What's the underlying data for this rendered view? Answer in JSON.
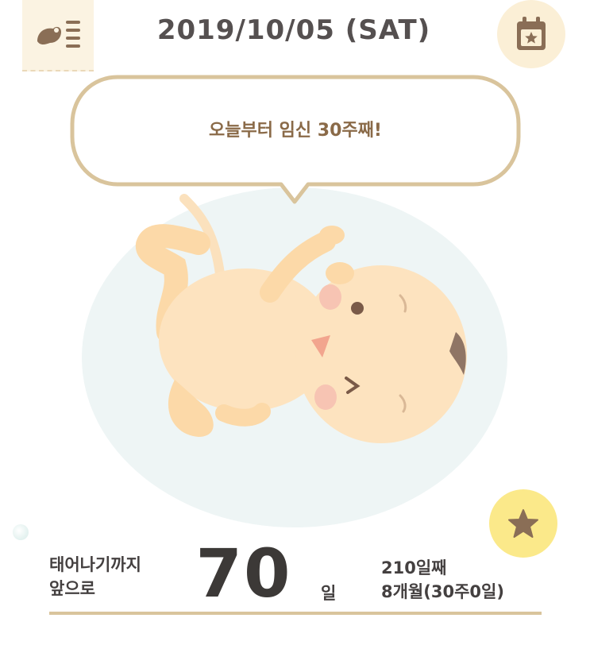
{
  "header": {
    "date": "2019/10/05 (SAT)",
    "menu_icon": "fetus-list-icon",
    "calendar_icon": "calendar-star-icon"
  },
  "bubble": {
    "message": "오늘부터 임신 30주째!"
  },
  "illustration": {
    "subject": "fetus",
    "icon": "fetus-illustration"
  },
  "favorite": {
    "icon": "star-icon"
  },
  "countdown": {
    "label_line1": "태어나기까지",
    "label_line2": "앞으로",
    "days_remaining": "70",
    "days_unit": "일",
    "day_count": "210일째",
    "month_week": "8개월(30주0일)"
  },
  "colors": {
    "accent_border": "#d9c49c",
    "bubble_text": "#8a6a48",
    "menu_bg": "#fbf3e2",
    "calendar_bg": "#fbefd6",
    "favorite_bg": "#fbe98a",
    "icon_brown": "#8a6e56",
    "womb_bg": "#eef5f5",
    "skin": "#fde3bf"
  }
}
